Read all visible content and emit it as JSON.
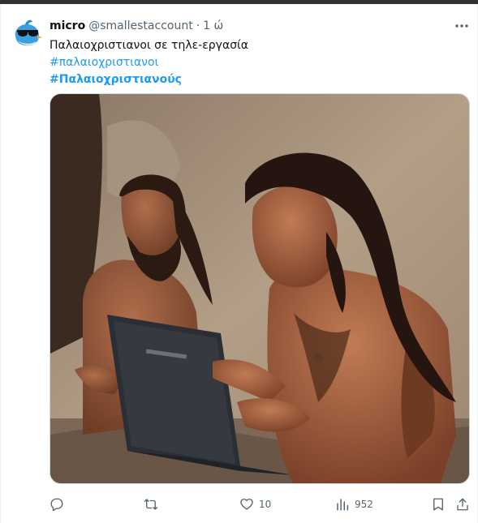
{
  "header_bar": {
    "color": "#2f3336"
  },
  "tweet": {
    "author": {
      "name": "micro",
      "handle": "@smallestaccount",
      "separator": "·",
      "time": "1 ώ",
      "avatar_icon": "bird-with-sunglasses-icon"
    },
    "text": "Παλαιοχριστιανοι σε τηλε-εργασία",
    "hashtags": [
      "#παλαιοχριστιανοι",
      "#Παλαιοχριστιανούς"
    ],
    "hashtag_color": "#1d9bf0",
    "media_icon": "cavemen-using-laptop-photo",
    "more_icon": "ellipsis-icon"
  },
  "actions": {
    "reply": {
      "icon": "reply-icon",
      "count": ""
    },
    "retweet": {
      "icon": "retweet-icon",
      "count": ""
    },
    "like": {
      "icon": "heart-icon",
      "count": "10"
    },
    "views": {
      "icon": "views-chart-icon",
      "count": "952"
    },
    "bookmark": {
      "icon": "bookmark-icon"
    },
    "share": {
      "icon": "share-icon"
    }
  }
}
